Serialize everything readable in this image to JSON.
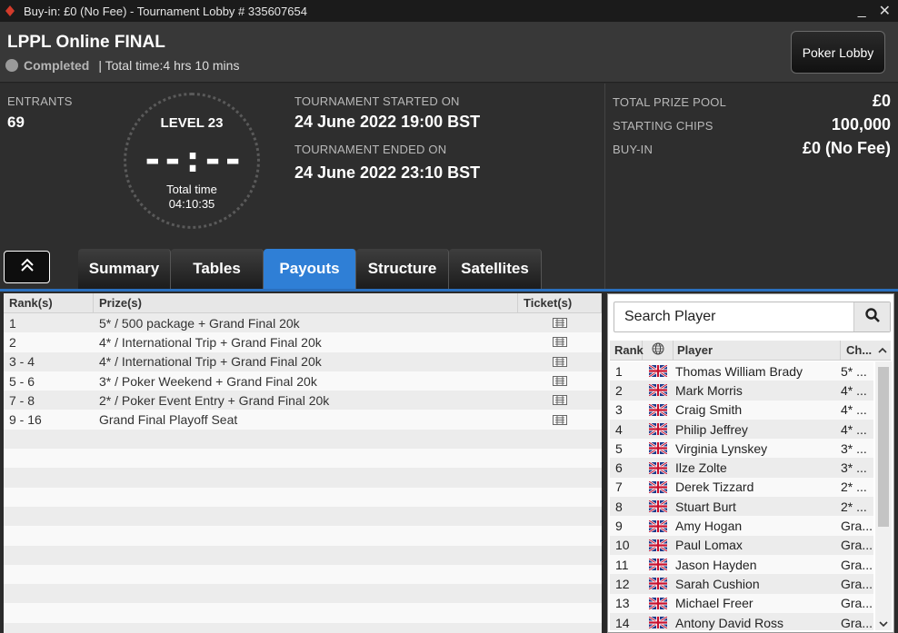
{
  "window": {
    "title": "Buy-in: £0 (No Fee) - Tournament Lobby # 335607654",
    "minimize": "_",
    "close": "✕"
  },
  "header": {
    "name": "LPPL Online FINAL",
    "status": "Completed",
    "total_time": "| Total time:4 hrs  10 mins",
    "lobby_button": "Poker Lobby"
  },
  "info": {
    "entrants_label": "ENTRANTS",
    "entrants_value": "69",
    "level": "LEVEL 23",
    "clock": "--:--",
    "total_time_label": "Total time",
    "total_time_value": "04:10:35",
    "started_label": "TOURNAMENT STARTED ON",
    "started_value": "24 June 2022  19:00 BST",
    "ended_label": "TOURNAMENT ENDED ON",
    "ended_value": "24 June 2022  23:10 BST",
    "prize_pool_label": "TOTAL PRIZE POOL",
    "prize_pool_value": "£0",
    "chips_label": "STARTING CHIPS",
    "chips_value": "100,000",
    "buyin_label": "BUY-IN",
    "buyin_value": "£0 (No Fee)"
  },
  "tabs": [
    "Summary",
    "Tables",
    "Payouts",
    "Structure",
    "Satellites"
  ],
  "active_tab": "Payouts",
  "payouts": {
    "headers": {
      "rank": "Rank(s)",
      "prize": "Prize(s)",
      "ticket": "Ticket(s)"
    },
    "rows": [
      {
        "rank": "1",
        "prize": "5* / 500 package + Grand Final 20k"
      },
      {
        "rank": "2",
        "prize": "4* / International Trip + Grand Final 20k"
      },
      {
        "rank": "3 - 4",
        "prize": "4* / International Trip + Grand Final 20k"
      },
      {
        "rank": "5 - 6",
        "prize": "3* / Poker Weekend + Grand Final 20k"
      },
      {
        "rank": "7 - 8",
        "prize": "2* / Poker Event Entry + Grand Final 20k"
      },
      {
        "rank": "9 - 16",
        "prize": "Grand Final Playoff Seat"
      }
    ],
    "empty_rows": 11
  },
  "players": {
    "search_placeholder": "Search Player",
    "headers": {
      "rank": "Rank",
      "player": "Player",
      "chips": "Ch..."
    },
    "rows": [
      {
        "rank": "1",
        "name": "Thomas William Brady",
        "chips": "5* ..."
      },
      {
        "rank": "2",
        "name": "Mark Morris",
        "chips": "4* ..."
      },
      {
        "rank": "3",
        "name": "Craig Smith",
        "chips": "4* ..."
      },
      {
        "rank": "4",
        "name": "Philip Jeffrey",
        "chips": "4* ..."
      },
      {
        "rank": "5",
        "name": "Virginia Lynskey",
        "chips": "3* ..."
      },
      {
        "rank": "6",
        "name": "Ilze Zolte",
        "chips": "3* ..."
      },
      {
        "rank": "7",
        "name": "Derek Tizzard",
        "chips": "2* ..."
      },
      {
        "rank": "8",
        "name": "Stuart Burt",
        "chips": "2* ..."
      },
      {
        "rank": "9",
        "name": "Amy Hogan",
        "chips": "Gra..."
      },
      {
        "rank": "10",
        "name": "Paul Lomax",
        "chips": "Gra..."
      },
      {
        "rank": "11",
        "name": "Jason Hayden",
        "chips": "Gra..."
      },
      {
        "rank": "12",
        "name": "Sarah Cushion",
        "chips": "Gra..."
      },
      {
        "rank": "13",
        "name": "Michael Freer",
        "chips": "Gra..."
      },
      {
        "rank": "14",
        "name": "Antony David Ross",
        "chips": "Gra..."
      }
    ]
  },
  "colors": {
    "accent": "#2f7fd6",
    "background": "#2e2e2e",
    "titlebar": "#1b1b1b"
  },
  "icons": {
    "logo": "spade-logo-icon",
    "search": "search-icon",
    "ticket": "ticket-icon",
    "flag": "uk-flag-icon",
    "globe": "globe-icon",
    "collapse": "double-chevron-up-icon"
  }
}
